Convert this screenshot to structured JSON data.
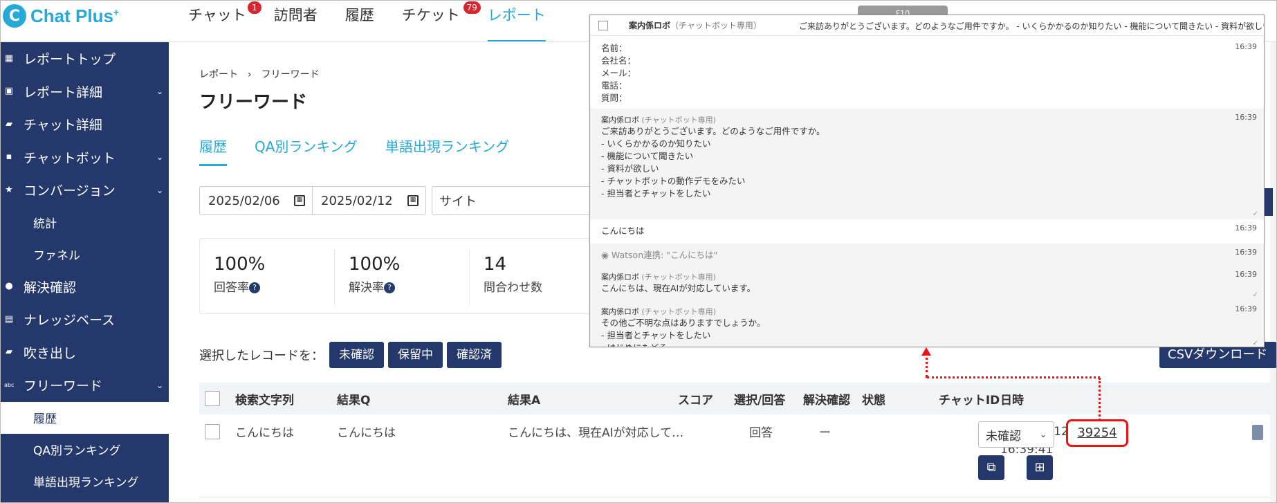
{
  "logo": {
    "mark": "C",
    "text": "Chat Plus",
    "sup": "+"
  },
  "nav": [
    {
      "label": "チャット",
      "badge": "1"
    },
    {
      "label": "訪問者",
      "badge": ""
    },
    {
      "label": "履歴",
      "badge": ""
    },
    {
      "label": "チケット",
      "badge": "79"
    },
    {
      "label": "レポート",
      "badge": ""
    }
  ],
  "sidebar": {
    "items": [
      {
        "label": "レポートトップ",
        "chev": ""
      },
      {
        "label": "レポート詳細",
        "chev": "⌄"
      },
      {
        "label": "チャット詳細",
        "chev": ""
      },
      {
        "label": "チャットボット",
        "chev": "⌄"
      },
      {
        "label": "コンバージョン",
        "chev": "⌄"
      }
    ],
    "conv_sub": [
      "統計",
      "ファネル"
    ],
    "items2": [
      {
        "label": "解決確認",
        "chev": ""
      },
      {
        "label": "ナレッジベース",
        "chev": ""
      },
      {
        "label": "吹き出し",
        "chev": ""
      },
      {
        "label": "フリーワード",
        "chev": "⌄"
      }
    ],
    "free_sub": [
      "履歴",
      "QA別ランキング",
      "単語出現ランキング"
    ]
  },
  "page": {
    "breadcrumb": "レポート　›　フリーワード",
    "title": "フリーワード",
    "tabs": [
      "履歴",
      "QA別ランキング",
      "単語出現ランキング"
    ],
    "date_from": "2025/02/06",
    "date_to": "2025/02/12",
    "site_placeholder": "サイト"
  },
  "stats": [
    {
      "value": "100%",
      "label": "回答率",
      "help": "?"
    },
    {
      "value": "100%",
      "label": "解決率",
      "help": "?"
    },
    {
      "value": "14",
      "label": "問合わせ数",
      "help": ""
    }
  ],
  "actions": {
    "label": "選択したレコードを：",
    "buttons": [
      "未確認",
      "保留中",
      "確認済"
    ],
    "csv": "CSVダウンロード"
  },
  "table": {
    "headers": [
      "検索文字列",
      "結果Q",
      "結果A",
      "スコア",
      "選択/回答",
      "解決確認",
      "状態",
      "チャットID",
      "日時"
    ],
    "row": {
      "query": "こんにちは",
      "result_q": "こんにちは",
      "result_a": "こんにちは、現在AIが対応して…",
      "score": "",
      "select_answer": "回答",
      "resolved": "ー",
      "status": "未確認",
      "chat_id": "39254",
      "date": "2025-02-12",
      "time": "16:39:41"
    }
  },
  "popup": {
    "header_name": "案内係ロボ",
    "header_sub": "（チャットボット専用）",
    "header_msg": "ご来訪ありがとうございます。どのようなご用件ですか。 - いくらかかるのか知りたい - 機能について聞きたい - 資料が欲しい",
    "form_lines": [
      "名前：",
      "会社名：",
      "メール：",
      "電話：",
      "質問："
    ],
    "t1": "16:39",
    "bot_name": "案内係ロボ",
    "bot_sub": "(チャットボット専用)",
    "msg2_lines": [
      "ご来訪ありがとうございます。どのようなご用件ですか。",
      "- いくらかかるのか知りたい",
      "- 機能について聞きたい",
      "- 資料が欲しい",
      "- チャットボットの動作デモをみたい",
      "- 担当者とチャットをしたい"
    ],
    "t2": "16:39",
    "user_msg": "こんにちは",
    "t3": "16:39",
    "watson": "Watson連携: \"こんにちは\"",
    "t4": "16:39",
    "msg5": "こんにちは、現在AIが対応しています。",
    "t5": "16:39",
    "msg6_lines": [
      "その他ご不明な点はありますでしょうか。",
      "- 担当者とチャットをしたい",
      "- はじめにもどる"
    ],
    "t6": "16:39",
    "tick": "✓"
  },
  "topright_text": "F10"
}
